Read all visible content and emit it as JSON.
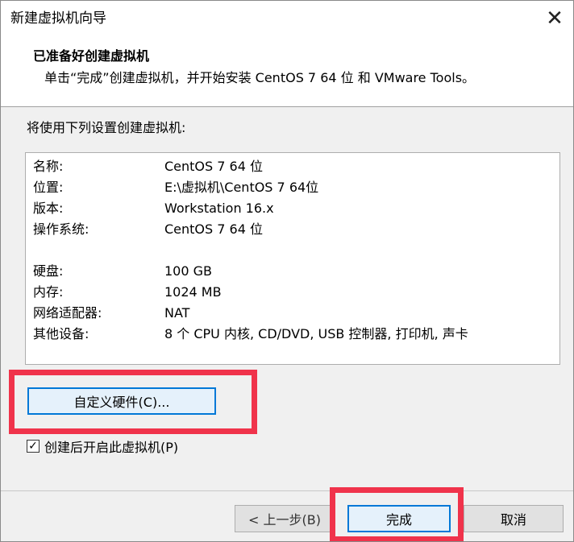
{
  "window": {
    "title": "新建虚拟机向导",
    "close_glyph": "✕"
  },
  "header": {
    "title": "已准备好创建虚拟机",
    "subtitle": "单击“完成”创建虚拟机，并开始安装 CentOS 7 64 位 和 VMware Tools。"
  },
  "intro": "将使用下列设置创建虚拟机:",
  "summary": {
    "rows": [
      {
        "label": "名称:",
        "value": "CentOS 7 64 位"
      },
      {
        "label": "位置:",
        "value": "E:\\虚拟机\\CentOS 7 64位"
      },
      {
        "label": "版本:",
        "value": "Workstation 16.x"
      },
      {
        "label": "操作系统:",
        "value": "CentOS 7 64 位"
      },
      {
        "label": "硬盘:",
        "value": "100 GB"
      },
      {
        "label": "内存:",
        "value": "1024 MB"
      },
      {
        "label": "网络适配器:",
        "value": "NAT"
      },
      {
        "label": "其他设备:",
        "value": "8 个 CPU 内核, CD/DVD, USB 控制器, 打印机, 声卡"
      }
    ]
  },
  "buttons": {
    "customize": "自定义硬件(C)...",
    "back": "< 上一步(B)",
    "finish": "完成",
    "cancel": "取消"
  },
  "power_on": {
    "label": "创建后开启此虚拟机(P)",
    "checked": true,
    "check_glyph": "✓"
  },
  "colors": {
    "highlight": "#f0334b",
    "focus_border": "#0078d7",
    "focus_fill": "#e5f1fb"
  }
}
